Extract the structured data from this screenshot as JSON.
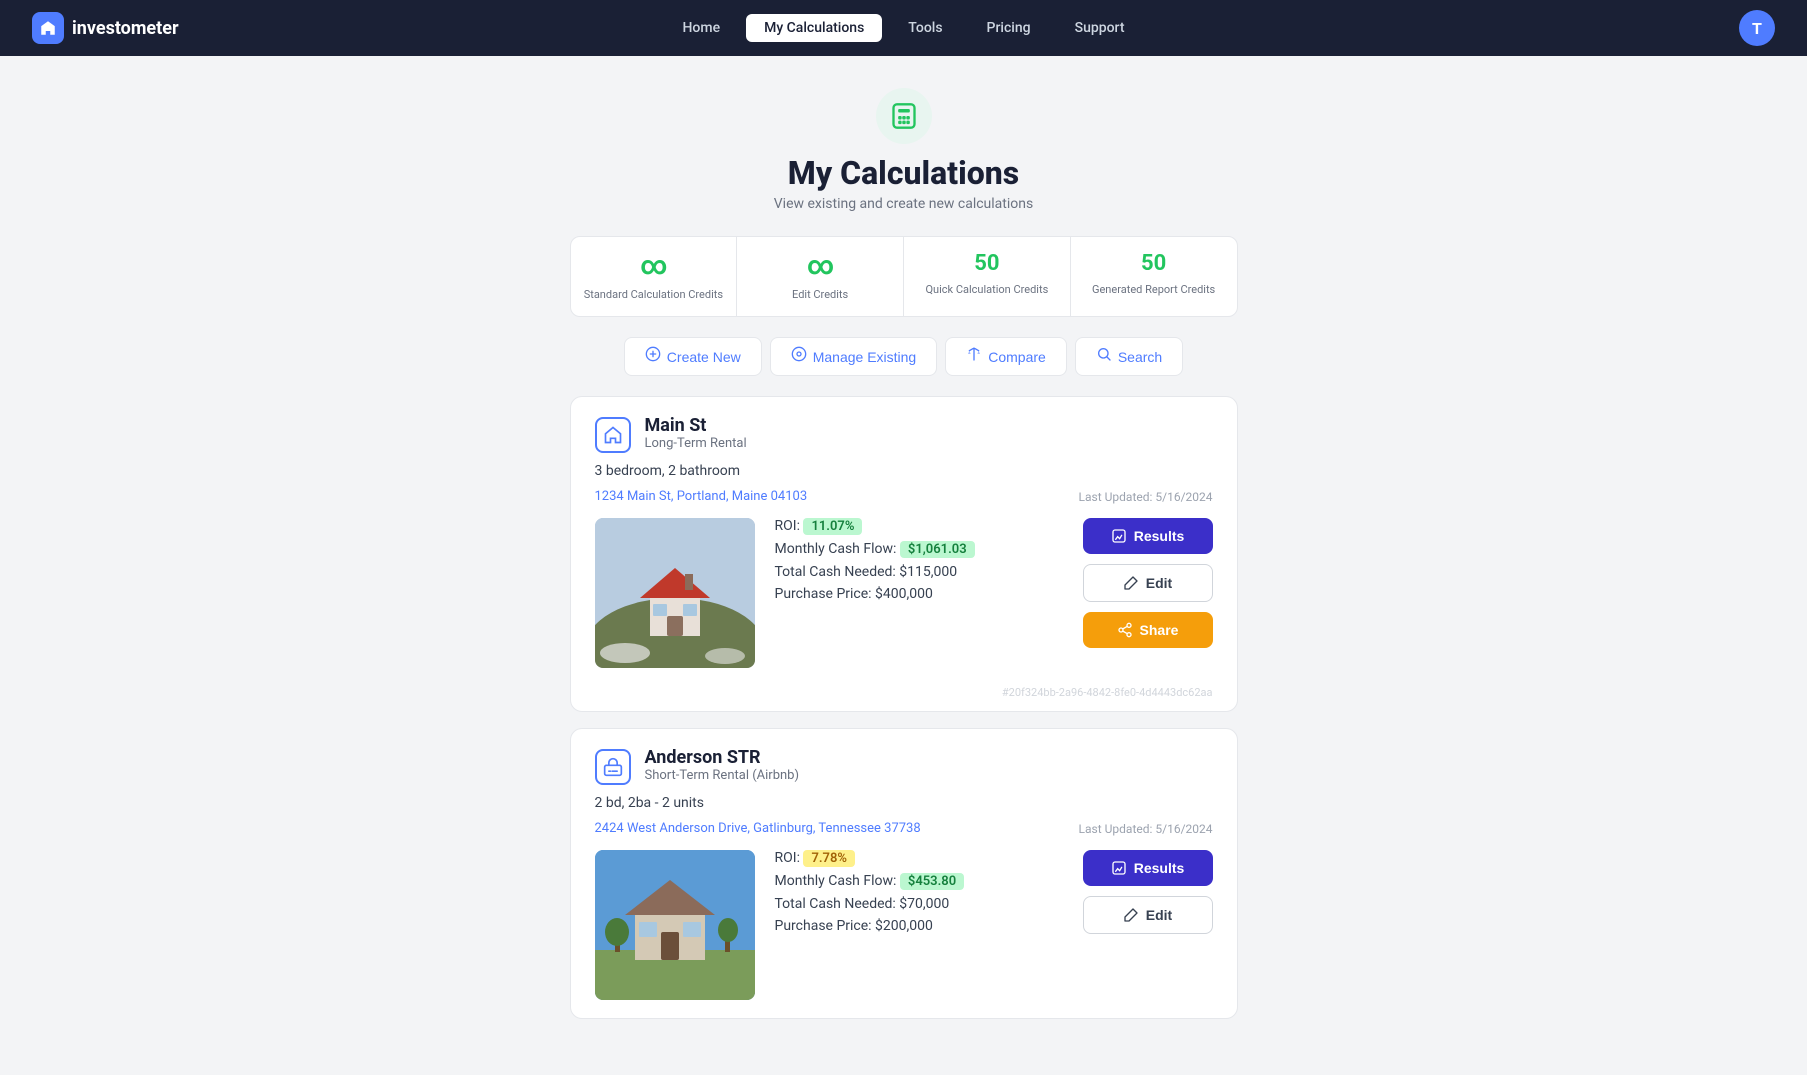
{
  "nav": {
    "logo_text": "investometer",
    "links": [
      {
        "label": "Home",
        "active": false
      },
      {
        "label": "My Calculations",
        "active": true
      },
      {
        "label": "Tools",
        "active": false
      },
      {
        "label": "Pricing",
        "active": false
      },
      {
        "label": "Support",
        "active": false
      }
    ],
    "avatar_initial": "T"
  },
  "page": {
    "title": "My Calculations",
    "subtitle": "View existing and create new calculations"
  },
  "credits": [
    {
      "label": "Standard Calculation Credits",
      "value": "∞",
      "is_infinity": true
    },
    {
      "label": "Edit Credits",
      "value": "∞",
      "is_infinity": true
    },
    {
      "label": "Quick Calculation Credits",
      "value": "50",
      "is_infinity": false
    },
    {
      "label": "Generated Report Credits",
      "value": "50",
      "is_infinity": false
    }
  ],
  "actions": [
    {
      "label": "Create New",
      "icon": "plus-circle"
    },
    {
      "label": "Manage Existing",
      "icon": "settings-circle"
    },
    {
      "label": "Compare",
      "icon": "balance"
    },
    {
      "label": "Search",
      "icon": "search"
    }
  ],
  "calculations": [
    {
      "name": "Main St",
      "type": "Long-Term Rental",
      "type_icon": "home",
      "bedrooms": "3 bedroom, 2 bathroom",
      "address": "1234 Main St, Portland, Maine 04103",
      "last_updated": "Last Updated: 5/16/2024",
      "roi": "11.07%",
      "roi_color": "green",
      "monthly_cash_flow": "$1,061.03",
      "cashflow_color": "green",
      "total_cash_needed": "$115,000",
      "purchase_price": "$400,000",
      "hash": "#20f324bb-2a96-4842-8fe0-4d4443dc62aa",
      "image_type": "house1"
    },
    {
      "name": "Anderson STR",
      "type": "Short-Term Rental (Airbnb)",
      "type_icon": "chart",
      "bedrooms": "2 bd, 2ba - 2 units",
      "address": "2424 West Anderson Drive, Gatlinburg, Tennessee 37738",
      "last_updated": "Last Updated: 5/16/2024",
      "roi": "7.78%",
      "roi_color": "yellow",
      "monthly_cash_flow": "$453.80",
      "cashflow_color": "green",
      "total_cash_needed": "$70,000",
      "purchase_price": "$200,000",
      "hash": "",
      "image_type": "house2"
    }
  ],
  "buttons": {
    "results": "Results",
    "edit": "Edit",
    "share": "Share"
  }
}
